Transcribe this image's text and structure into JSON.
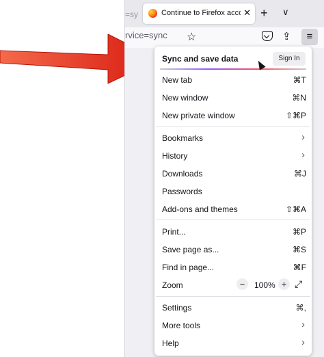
{
  "tabs": {
    "previous_tab_text": "=sy",
    "active_tab_title": "Continue to Firefox account",
    "close_glyph": "✕",
    "new_tab_glyph": "+",
    "list_all_glyph": "∨"
  },
  "toolbar": {
    "url_fragment": "rvice=sync",
    "bookmark_icon": "☆",
    "share_icon": "⇪",
    "menu_icon": "≡"
  },
  "menu": {
    "sync_title": "Sync and save data",
    "sign_in_label": "Sign In",
    "items": [
      {
        "label": "New tab",
        "shortcut": "⌘T"
      },
      {
        "label": "New window",
        "shortcut": "⌘N"
      },
      {
        "label": "New private window",
        "shortcut": "⇧⌘P"
      },
      {
        "label": "Bookmarks",
        "chevron": "›"
      },
      {
        "label": "History",
        "chevron": "›"
      },
      {
        "label": "Downloads",
        "shortcut": "⌘J"
      },
      {
        "label": "Passwords"
      },
      {
        "label": "Add-ons and themes",
        "shortcut": "⇧⌘A"
      },
      {
        "label": "Print...",
        "shortcut": "⌘P"
      },
      {
        "label": "Save page as...",
        "shortcut": "⌘S"
      },
      {
        "label": "Find in page...",
        "shortcut": "⌘F"
      },
      {
        "label": "Zoom"
      },
      {
        "label": "Settings",
        "shortcut": "⌘,"
      },
      {
        "label": "More tools",
        "chevron": "›"
      },
      {
        "label": "Help",
        "chevron": "›"
      }
    ],
    "zoom": {
      "minus": "−",
      "value": "100%",
      "plus": "+",
      "fullscreen": "⤢"
    }
  },
  "colors": {
    "arrow": "#e32212",
    "menu_bg": "#ffffff",
    "chrome_bg": "#f0f0f4"
  }
}
